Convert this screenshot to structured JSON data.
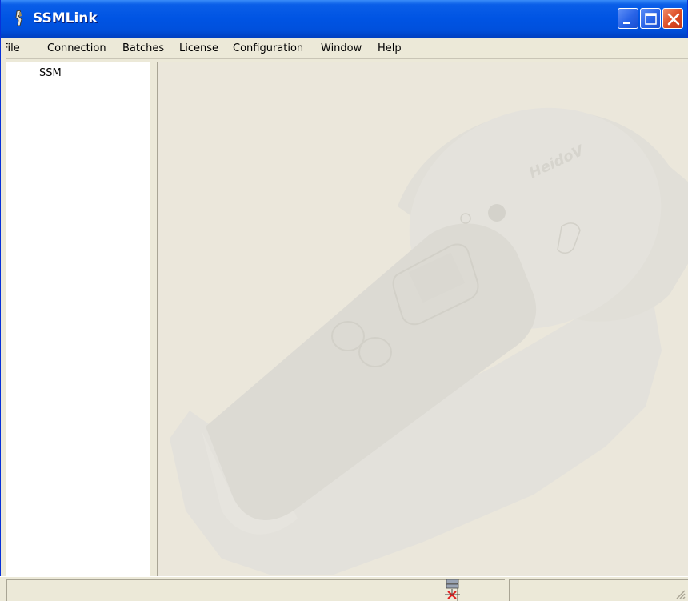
{
  "window": {
    "title": "SSMLink",
    "app_icon": "app-icon",
    "controls": [
      "minimize-icon",
      "maximize-icon",
      "close-icon"
    ]
  },
  "menu": {
    "items": [
      {
        "label": "File"
      },
      {
        "label": "Connection"
      },
      {
        "label": "Batches"
      },
      {
        "label": "License"
      },
      {
        "label": "Configuration"
      },
      {
        "label": "Window"
      },
      {
        "label": "Help"
      }
    ]
  },
  "tree": {
    "items": [
      {
        "label": "SSM"
      }
    ]
  },
  "main": {
    "background_image": "handheld-device-watermark",
    "device_brand": "HeidoV"
  },
  "status": {
    "connection_icon": "network-disconnected-icon",
    "panes": [
      "",
      "",
      ""
    ]
  },
  "colors": {
    "titlebar": "#0054e3",
    "chrome": "#ece9d8",
    "close_button": "#dc4a22"
  }
}
